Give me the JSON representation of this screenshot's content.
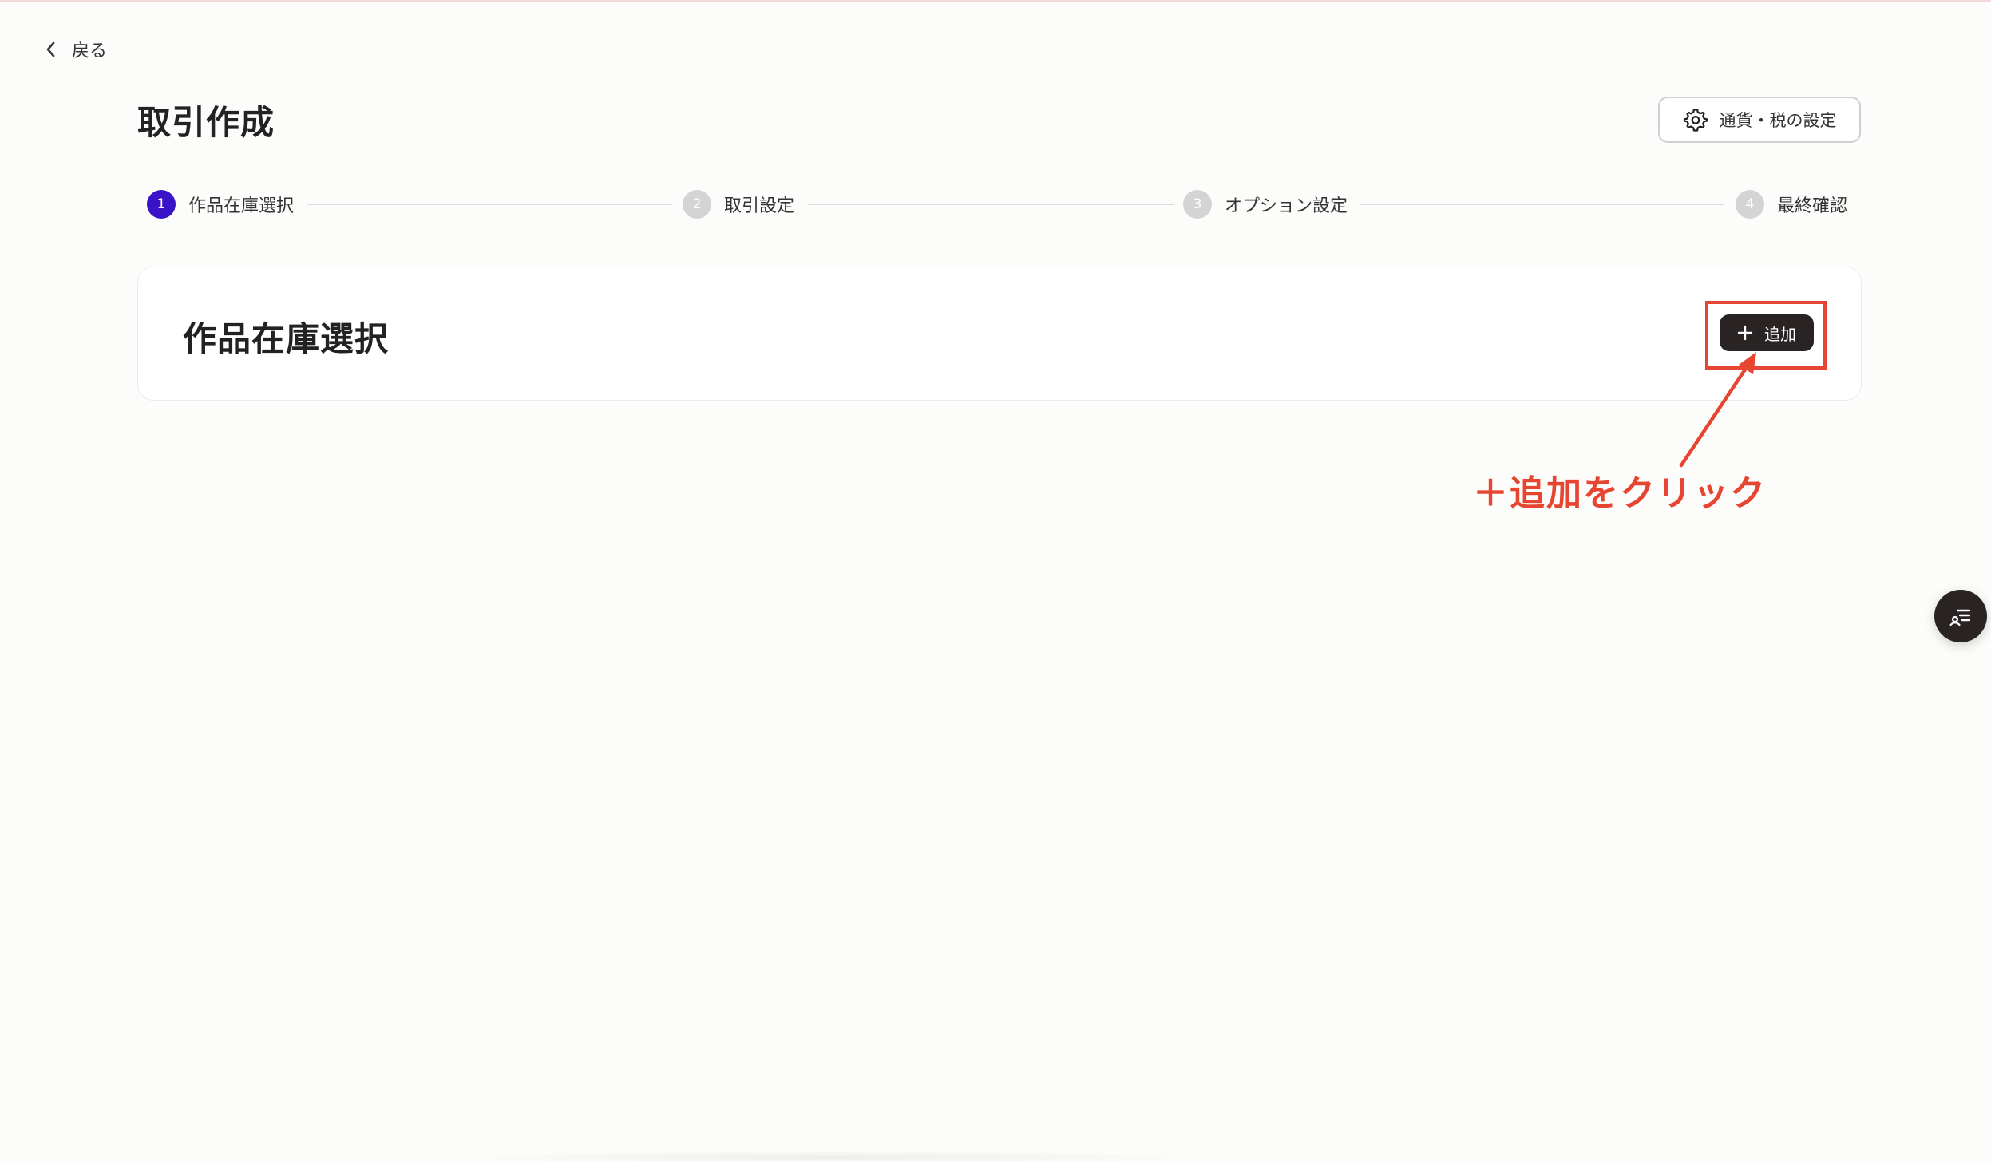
{
  "nav": {
    "back_label": "戻る"
  },
  "header": {
    "title": "取引作成",
    "settings_label": "通貨・税の設定"
  },
  "stepper": {
    "steps": [
      {
        "number": "1",
        "label": "作品在庫選択",
        "state": "active"
      },
      {
        "number": "2",
        "label": "取引設定",
        "state": "inactive"
      },
      {
        "number": "3",
        "label": "オプション設定",
        "state": "inactive"
      },
      {
        "number": "4",
        "label": "最終確認",
        "state": "inactive"
      }
    ]
  },
  "card": {
    "title": "作品在庫選択",
    "add_label": "追加"
  },
  "annotation": {
    "text": "＋追加をクリック",
    "color": "#e64532"
  },
  "colors": {
    "accent": "#3a12c8",
    "dark_button": "#2a2323",
    "annotation": "#e64532"
  },
  "icons": {
    "back": "chevron-left-icon",
    "settings": "gear-icon",
    "add": "plus-icon",
    "float": "list-user-icon"
  }
}
